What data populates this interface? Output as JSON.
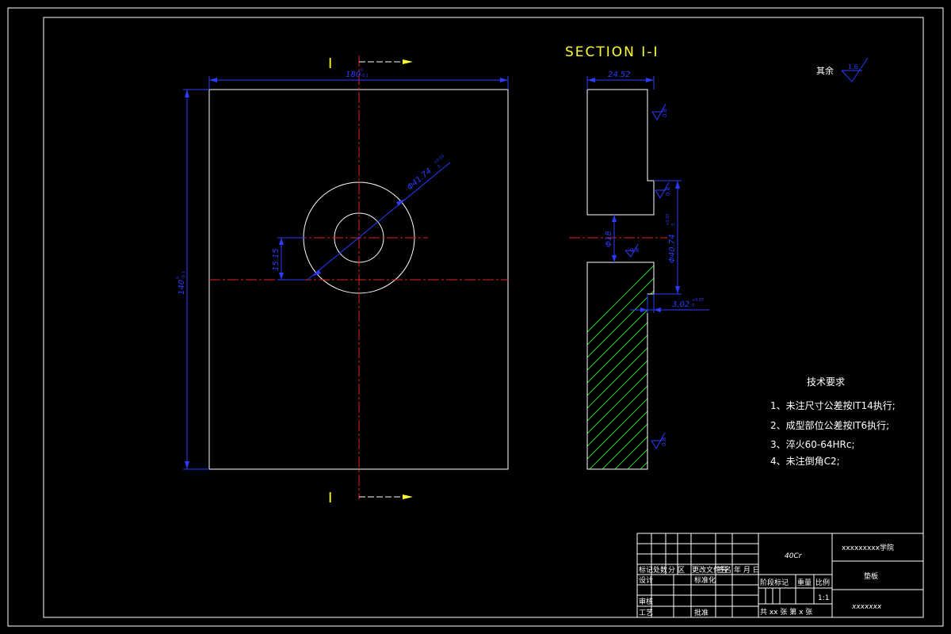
{
  "section_title": "SECTION I-I",
  "section_marks": {
    "top": "I",
    "bottom": "I"
  },
  "surface_note": {
    "label": "其余",
    "roughness": "1.6"
  },
  "dimensions": {
    "width": "180",
    "width_tol": "0\n-0.1",
    "height": "140",
    "height_tol": "0\n-0.1",
    "bore_dia": "Φ41.74",
    "bore_tol": "+0.03\n0",
    "offset": "15.15",
    "thickness": "24.52",
    "hole_dia": "Φ18",
    "counter_dia": "Φ40.74",
    "counter_tol": "+0.03\n0",
    "depth": "3.02",
    "depth_tol": "+0.07\n0",
    "rough_1": "0.8",
    "rough_2": "0.8",
    "rough_3": "0.8",
    "rough_4": "0.8"
  },
  "tech_requirements": {
    "title": "技术要求",
    "items": [
      "1、未注尺寸公差按IT14执行;",
      "2、成型部位公差按IT6执行;",
      "3、淬火60-64HRc;",
      "4、未注倒角C2;"
    ]
  },
  "title_block": {
    "material": "40Cr",
    "school": "xxxxxxxxx学院",
    "drawing_name": "垫板",
    "drawing_no": "xxxxxxx",
    "scale": "1:1",
    "headers": [
      "标记",
      "处数",
      "分 区",
      "更改文件号",
      "签名",
      "年 月 日"
    ],
    "row_design": "设计",
    "row_standard": "标准化",
    "row_review": "审核",
    "row_process": "工艺",
    "row_approve": "批准",
    "stage_label": "阶段标记",
    "weight_label": "重量",
    "scale_label": "比例",
    "sheets": "共 xx 张  第 x 张"
  },
  "colors": {
    "outline": "#ffffff",
    "dimension": "#2b3bff",
    "centerline": "#e02020",
    "hatch": "#22cc22",
    "text": "#ffff33",
    "background": "#000000"
  }
}
